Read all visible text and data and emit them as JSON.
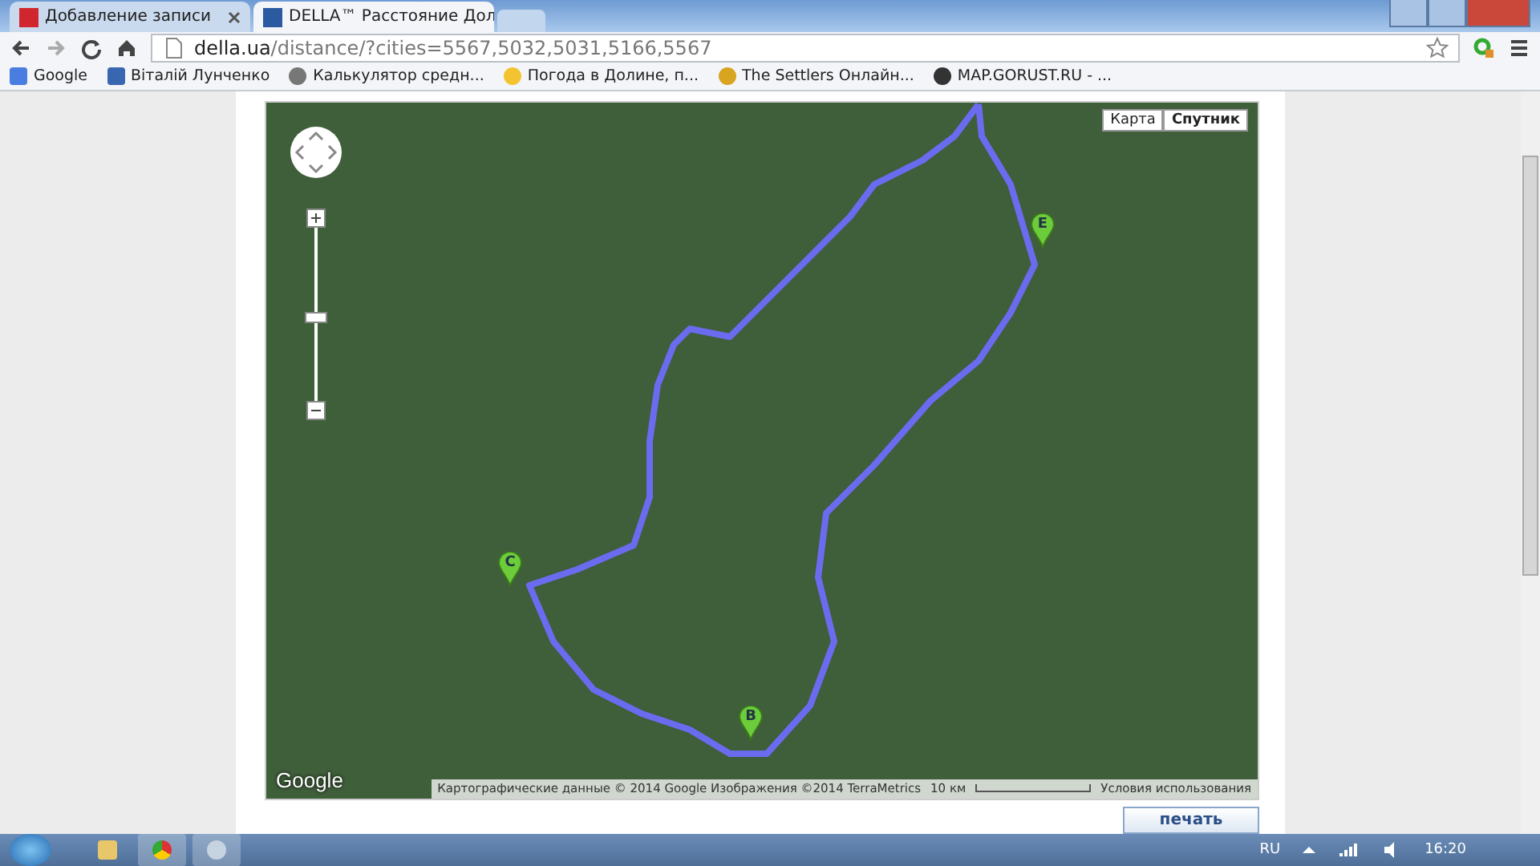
{
  "tabs": [
    {
      "title": "Добавление записи",
      "selected": false
    },
    {
      "title": "DELLA™ Расстояние Дол",
      "selected": true
    }
  ],
  "address": {
    "host": "della.ua",
    "path": "/distance/?cities=5567,5032,5031,5166,5567"
  },
  "bookmarks": [
    {
      "label": "Google"
    },
    {
      "label": "Віталій Лунченко"
    },
    {
      "label": "Калькулятор средн..."
    },
    {
      "label": "Погода в Долине, п..."
    },
    {
      "label": "The Settlers Онлайн..."
    },
    {
      "label": "MAP.GORUST.RU - ..."
    }
  ],
  "map": {
    "map_types": [
      {
        "label": "Карта",
        "selected": false
      },
      {
        "label": "Спутник",
        "selected": true
      }
    ],
    "zoom": {
      "level": 0.48
    },
    "markers": [
      {
        "letter": "E"
      },
      {
        "letter": "C"
      },
      {
        "letter": "B"
      }
    ],
    "logo": "Google",
    "attribution": "Картографические данные © 2014 Google Изображения ©2014 TerraMetrics",
    "scale": "10 км",
    "terms": "Условия использования"
  },
  "print_button": "печать",
  "taskbar": {
    "language": "RU",
    "clock": "16:20"
  }
}
